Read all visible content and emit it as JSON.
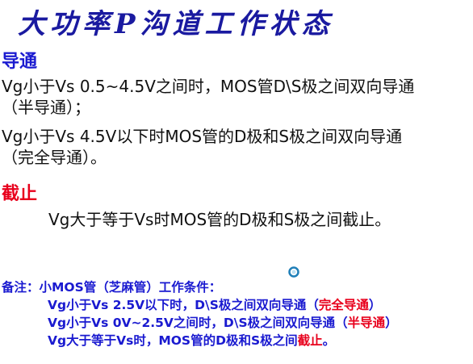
{
  "title": "大功率P沟道工作状态",
  "conduction": {
    "heading": "导通",
    "line1": "Vg小于Vs 0.5~4.5V之间时，MOS管D\\S极之间双向导通",
    "line2": "（半导通）；",
    "line3": "Vg小于Vs 4.5V以下时MOS管的D极和S极之间双向导通",
    "line4": "（完全导通）。"
  },
  "cutoff": {
    "heading": "截止",
    "line1": "Vg大于等于Vs时MOS管的D极和S极之间截止。"
  },
  "note": {
    "line1": "备注：小MOS管（芝麻管）工作条件：",
    "line2_a": "Vg小于Vs 2.5V以下时，D\\S极之间双向导通（",
    "line2_red": "完全导通",
    "line2_b": "）",
    "line3_a": "Vg小于Vs 0V~2.5V之间时，D\\S极之间双向导通（",
    "line3_red": "半导通",
    "line3_b": "）",
    "line4_a": "Vg大于等于Vs时，MOS管的D极和S极之间",
    "line4_red": "截止",
    "line4_b": "。"
  },
  "icons": {
    "loader": "loading-spinner-icon"
  },
  "colors": {
    "blue": "#1a1ad0",
    "red": "#e8001c",
    "title": "#1a1aa0"
  }
}
